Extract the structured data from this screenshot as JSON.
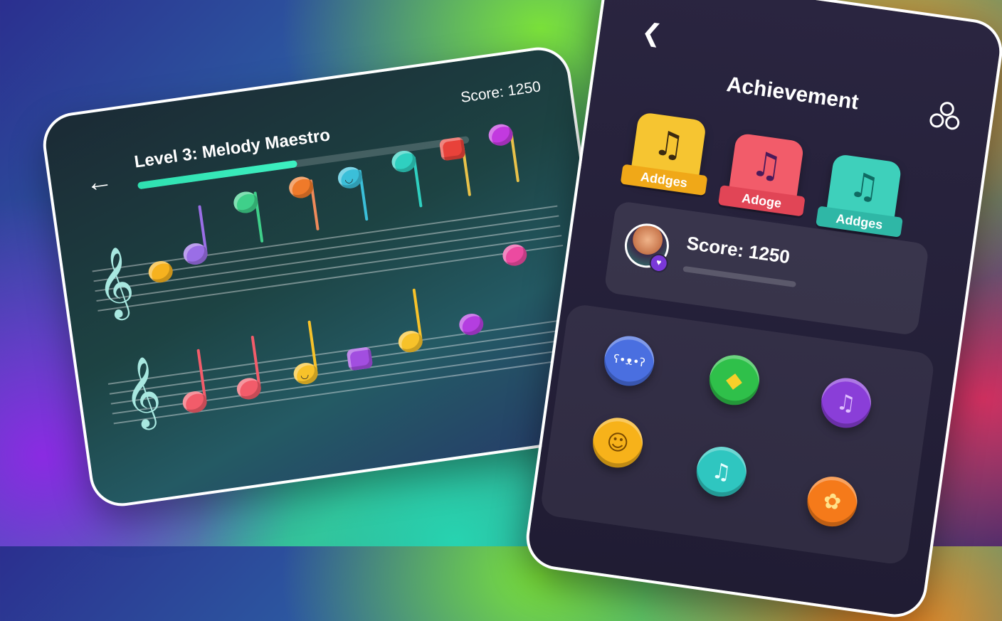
{
  "game": {
    "back_icon": "back-arrow-icon",
    "level_title": "Level 3: Melody Maestro",
    "score_text": "Score: 1250",
    "progress": 0.48,
    "colors": {
      "progress": "#2fe0b0",
      "accent": "#ffffff"
    }
  },
  "achievements": {
    "back_icon": "chevron-left-icon",
    "title": "Achievement",
    "share_icon": "share-circles-icon",
    "badges": [
      {
        "label": "Addges",
        "glyph": "♫",
        "color": "#f6c531",
        "ribbon": "#f0a818"
      },
      {
        "label": "Adoge",
        "glyph": "♫",
        "color": "#f25c6a",
        "ribbon": "#e14556"
      },
      {
        "label": "Addges",
        "glyph": "♫",
        "color": "#3ed0bb",
        "ribbon": "#2fb7a6"
      }
    ],
    "score_text": "Score: 1250",
    "coins": [
      {
        "name": "purple-bear-coin",
        "glyph": "ʕ•ᴥ•ʔ",
        "color": "#4a6fe0"
      },
      {
        "name": "green-smile-coin",
        "glyph": "◆",
        "color": "#2fc04a"
      },
      {
        "name": "violet-music-coin",
        "glyph": "♫",
        "color": "#8a3ed8"
      },
      {
        "name": "yellow-smile-coin",
        "glyph": "☺",
        "color": "#f7b21a"
      },
      {
        "name": "teal-music-coin",
        "glyph": "♫",
        "color": "#2fc6c0"
      },
      {
        "name": "orange-flame-coin",
        "glyph": "✿",
        "color": "#f57a1a"
      }
    ]
  }
}
